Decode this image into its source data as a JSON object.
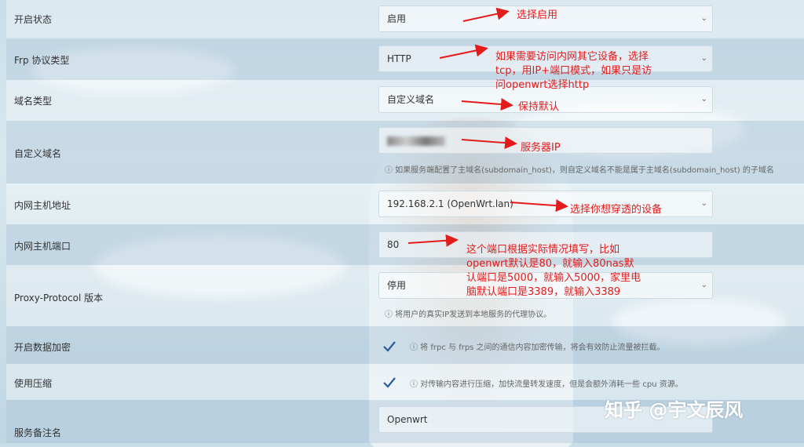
{
  "form": {
    "rows": [
      {
        "label": "开启状态",
        "value": "启用"
      },
      {
        "label": "Frp 协议类型",
        "value": "HTTP"
      },
      {
        "label": "域名类型",
        "value": "自定义域名"
      },
      {
        "label": "自定义域名",
        "value": "",
        "hint": "ⓘ 如果服务端配置了主域名(subdomain_host)，则自定义域名不能是属于主域名(subdomain_host) 的子域名"
      },
      {
        "label": "内网主机地址",
        "value": "192.168.2.1 (OpenWrt.lan)"
      },
      {
        "label": "内网主机端口",
        "value": "80"
      },
      {
        "label": "Proxy-Protocol 版本",
        "value": "停用",
        "hint": "ⓘ 将用户的真实IP发送到本地服务的代理协议。"
      },
      {
        "label": "开启数据加密",
        "checked": true,
        "hint": "ⓘ 将 frpc 与 frps 之间的通信内容加密传输，将会有效防止流量被拦截。"
      },
      {
        "label": "使用压缩",
        "checked": true,
        "hint": "ⓘ 对传输内容进行压缩，加快流量转发速度，但是会额外消耗一些 cpu 资源。"
      },
      {
        "label": "服务备注名",
        "value": "Openwrt"
      }
    ]
  },
  "annotations": {
    "enable": "选择启用",
    "protocol": "如果需要访问内网其它设备，选择tcp，用IP+端口模式，如果只是访问openwrt选择http",
    "domain_type": "保持默认",
    "custom_domain": "服务器IP",
    "host": "选择你想穿透的设备",
    "port": "这个端口根据实际情况填写，比如openwrt默认是80，就输入80nas默认端口是5000，就输入5000，家里电脑默认端口是3389，就输入3389"
  },
  "annotation_color": "#e31b1b",
  "watermark": "知乎 @宇文辰风"
}
